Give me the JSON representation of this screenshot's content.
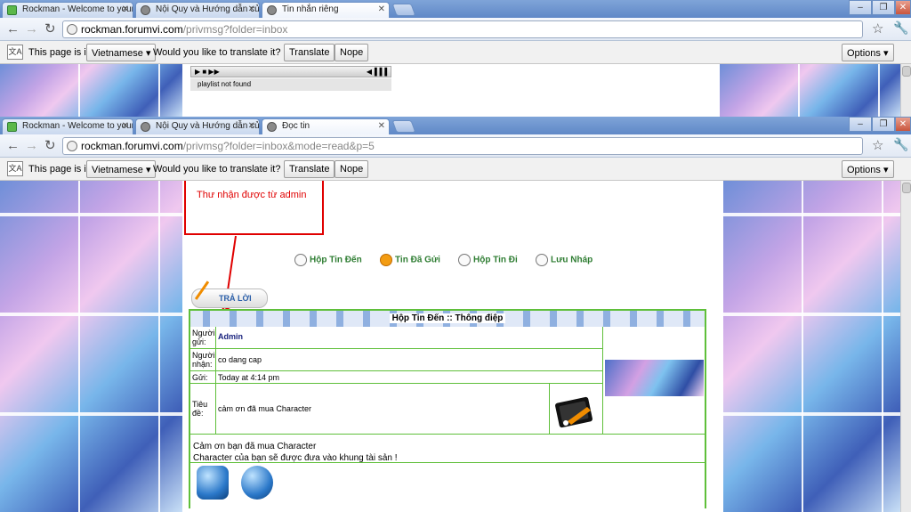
{
  "window_top": {
    "tabs": [
      {
        "label": "Rockman - Welcome to your f",
        "icon": "chat-icon"
      },
      {
        "label": "Nội Quy và Hướng dẫn của Fo",
        "icon": "forum-icon"
      },
      {
        "label": "Tin nhắn riêng",
        "icon": "forum-icon"
      }
    ],
    "url_host": "rockman.forumvi.com",
    "url_path": "/privmsg?folder=inbox",
    "translate": {
      "lang_prefix": "This page is in",
      "lang": "Vietnamese ▾",
      "question": "Would you like to translate it?",
      "translate_btn": "Translate",
      "nope_btn": "Nope",
      "options_btn": "Options ▾"
    },
    "player_controls": "▶ ■ ▶▶",
    "player_volume": "◀▐▐▐",
    "player_status": "playlist not found"
  },
  "window_bottom": {
    "tabs": [
      {
        "label": "Rockman - Welcome to your f",
        "icon": "chat-icon"
      },
      {
        "label": "Nội Quy và Hướng dẫn của Fo",
        "icon": "forum-icon"
      },
      {
        "label": "Đọc tin",
        "icon": "forum-icon"
      }
    ],
    "url_host": "rockman.forumvi.com",
    "url_path": "/privmsg?folder=inbox&mode=read&p=5",
    "translate": {
      "lang_prefix": "This page is in",
      "lang": "Vietnamese ▾",
      "question": "Would you like to translate it?",
      "translate_btn": "Translate",
      "nope_btn": "Nope",
      "options_btn": "Options ▾"
    }
  },
  "annotation": "Thư nhận được từ admin",
  "pm_nav": {
    "inbox": "Hộp Tin Đến",
    "sent": "Tin Đã Gửi",
    "outbox": "Hộp Tin Đi",
    "drafts": "Lưu Nháp"
  },
  "reply_label": "TRẢ LỜI",
  "message": {
    "header": "Hộp Tin Đến :: Thông điệp",
    "from_label": "Người gửi:",
    "from_value": "Admin",
    "to_label": "Người nhận:",
    "to_value": "co dang cap",
    "sent_label": "Gửi:",
    "sent_value": "Today at 4:14 pm",
    "subject_label": "Tiêu đề:",
    "subject_value": "cảm ơn đã mua Character",
    "body_line1": "Cảm ơn bạn đã mua Character",
    "body_line2": "Character của bạn sẽ được đưa vào khung tài sản !"
  }
}
